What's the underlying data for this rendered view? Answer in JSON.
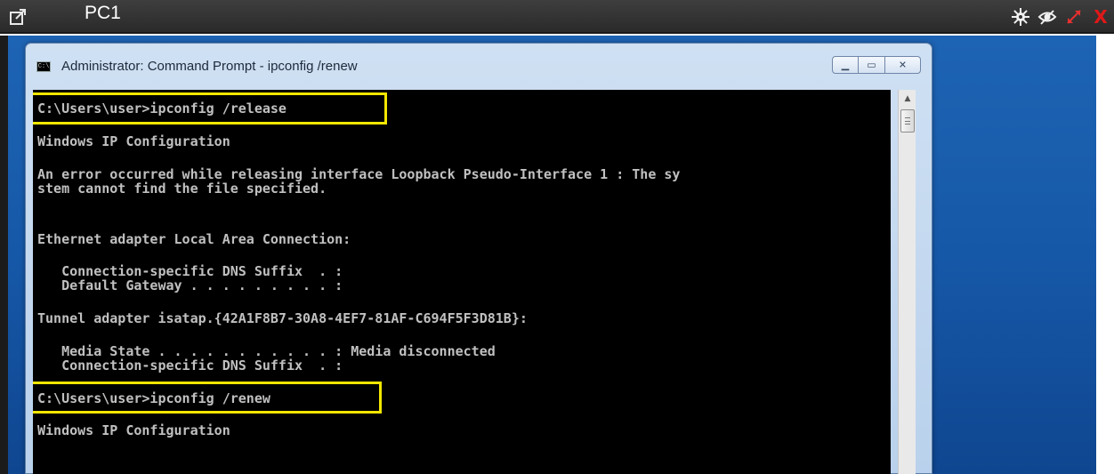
{
  "session": {
    "title": "PC1"
  },
  "window": {
    "title": "Administrator: Command Prompt - ipconfig  /renew"
  },
  "console": {
    "lines": [
      "C:\\Users\\user>ipconfig /release",
      "Windows IP Configuration",
      "An error occurred while releasing interface Loopback Pseudo-Interface 1 : The sy",
      "stem cannot find the file specified.",
      "Ethernet adapter Local Area Connection:",
      "   Connection-specific DNS Suffix  . :",
      "   Default Gateway . . . . . . . . . :",
      "Tunnel adapter isatap.{42A1F8B7-30A8-4EF7-81AF-C694F5F3D81B}:",
      "   Media State . . . . . . . . . . . : Media disconnected",
      "   Connection-specific DNS Suffix  . :",
      "C:\\Users\\user>ipconfig /renew",
      "Windows IP Configuration"
    ]
  },
  "colors": {
    "highlight": "#f2e600",
    "console_bg": "#000000",
    "console_text": "#c0c0c0",
    "close_icon": "#e01818"
  },
  "icons": [
    "popout-icon",
    "settings-gear-icon",
    "eye-icon",
    "resize-arrows-icon",
    "close-icon",
    "cmd-app-icon",
    "minimize-icon",
    "maximize-icon",
    "window-close-icon"
  ]
}
